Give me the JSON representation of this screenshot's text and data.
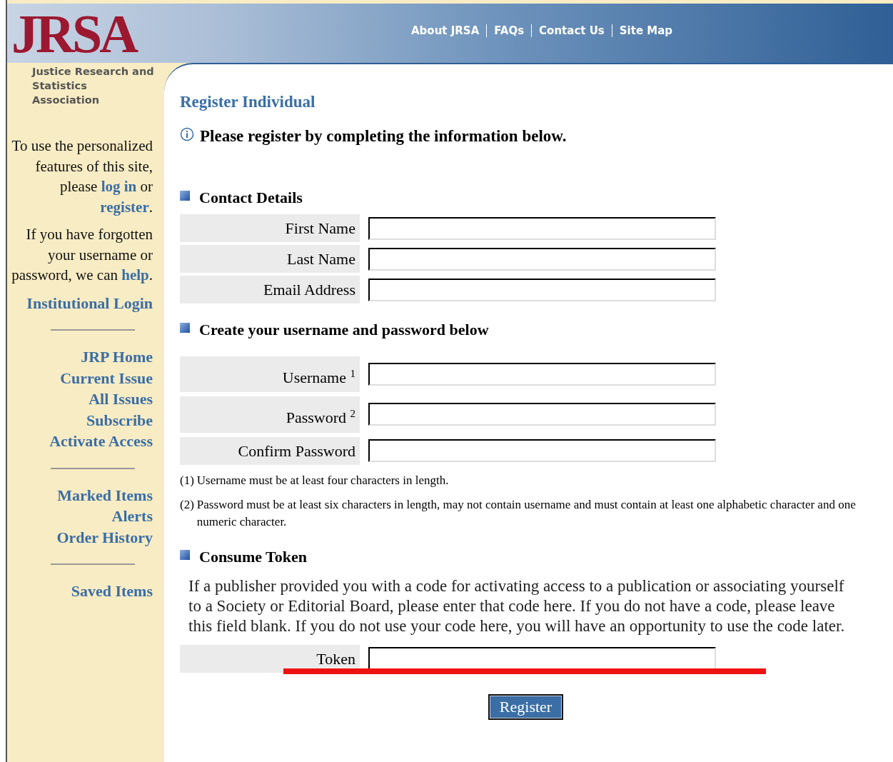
{
  "logo": {
    "text": "JRSA",
    "subtitle": "Justice Research and Statistics Association"
  },
  "top_nav": [
    "About JRSA",
    "FAQs",
    "Contact Us",
    "Site Map"
  ],
  "sidebar": {
    "paragraphs": [
      [
        {
          "kind": "text",
          "text": "To use the personalized features of this site, please "
        },
        {
          "kind": "link",
          "text": "log in"
        },
        {
          "kind": "text",
          "text": " or "
        },
        {
          "kind": "link",
          "text": "register"
        },
        {
          "kind": "text",
          "text": "."
        }
      ],
      [
        {
          "kind": "text",
          "text": "If you have forgotten your username or password, we can "
        },
        {
          "kind": "link",
          "text": "help"
        },
        {
          "kind": "text",
          "text": "."
        }
      ]
    ],
    "link_groups": [
      [
        "Institutional Login"
      ],
      [
        "JRP Home",
        "Current Issue",
        "All Issues",
        "Subscribe",
        "Activate Access"
      ],
      [
        "Marked Items",
        "Alerts",
        "Order History"
      ],
      [
        "Saved Items"
      ]
    ]
  },
  "main": {
    "title": "Register Individual",
    "notice": "Please register by completing the information below.",
    "sections": [
      {
        "heading": "Contact Details",
        "fields": [
          {
            "label": "First Name"
          },
          {
            "label": "Last Name"
          },
          {
            "label": "Email Address"
          }
        ]
      },
      {
        "heading": "Create your username and password below",
        "fields": [
          {
            "label": "Username $^{1}$"
          },
          {
            "label": "Password $^{2}$"
          },
          {
            "label": "Confirm Password"
          }
        ],
        "notes": [
          {
            "mark": "(1)",
            "text": "Username must be at least four characters in length."
          },
          {
            "mark": "(2)",
            "text": "Password must be at least six characters in length, may not contain username and must contain at least one alphabetic character and one numeric character."
          }
        ]
      },
      {
        "heading": "Consume Token",
        "text": "If a publisher provided you with a code for activating access to a publication or associating yourself to a Society or Editorial Board, please enter that code here. If you do not have a code, please leave this field blank. If you do not use your code here, you will have an opportunity to use the code later.",
        "fields": [
          {
            "label": "Token",
            "annotation": {
              "kind": "strikethrough",
              "color": "#ee1111"
            }
          }
        ]
      }
    ],
    "button": "Register"
  }
}
